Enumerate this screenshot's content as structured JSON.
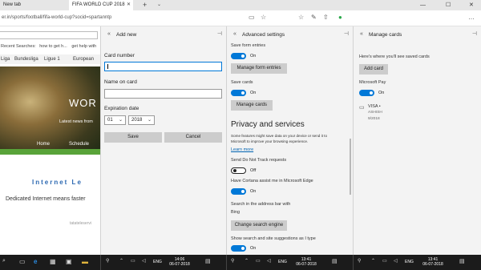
{
  "browser": {
    "tabs": [
      {
        "title": "New tab",
        "active": false
      },
      {
        "title": "FIFA WORLD CUP 2018",
        "active": true
      }
    ],
    "new_tab_icon": "plus-icon",
    "tab_menu_icon": "chevron-down-icon",
    "address_fragment": "er.in/sports/football/fifa-world-cup?socid=spartanntp",
    "window_controls": {
      "minimize": "—",
      "maximize": "☐",
      "close": "✕"
    }
  },
  "webpage": {
    "recent_label": "Recent Searches:",
    "recent_items": [
      "how to get h...",
      "get help with"
    ],
    "leagues": [
      "Liga",
      "Bundesliga",
      "Ligue 1",
      "European"
    ],
    "hero_title": "WOR",
    "hero_subtitle": "Latest news from",
    "hero_nav": [
      "Home",
      "Schedule"
    ],
    "ad_title": "Internet Le",
    "ad_text": "Dedicated Internet means faster",
    "ad_source": "tatateleservi"
  },
  "add_new_pane": {
    "title": "Add new",
    "card_number_label": "Card number",
    "card_number_value": "",
    "name_label": "Name on card",
    "name_value": "",
    "expiration_label": "Expiration date",
    "month_value": "01",
    "year_value": "2018",
    "save_label": "Save",
    "cancel_label": "Cancel"
  },
  "advanced_pane": {
    "title": "Advanced settings",
    "save_form_entries_label": "Save form entries",
    "save_form_entries_state": "On",
    "manage_form_entries_label": "Manage form entries",
    "save_cards_label": "Save cards",
    "save_cards_state": "On",
    "manage_cards_label": "Manage cards",
    "privacy_heading": "Privacy and services",
    "privacy_desc_line1": "Some features might save data on your device or send it to",
    "privacy_desc_line2": "Microsoft to improve your browsing experience.",
    "learn_more_label": "Learn more",
    "dnt_label": "Send Do Not Track requests",
    "dnt_state": "Off",
    "cortana_label": "Have Cortana assist me in Microsoft Edge",
    "cortana_state": "On",
    "search_bar_label": "Search in the address bar with",
    "search_engine_value": "Bing",
    "change_search_label": "Change search engine",
    "suggestions_label": "Show search and site suggestions as I type",
    "suggestions_state": "On"
  },
  "manage_cards_pane": {
    "title": "Manage cards",
    "intro": "Here's where you'll see saved cards",
    "add_card_label": "Add card",
    "microsoft_pay_label": "Microsoft Pay",
    "microsoft_pay_state": "On",
    "card_brand": "VISA •",
    "card_name": "ASHISH",
    "card_expiry": "9/2018"
  },
  "taskbars": [
    {
      "lang": "ENG",
      "time": "14:06",
      "date": "06-07-2018"
    },
    {
      "lang": "ENG",
      "time": "13:41",
      "date": "06-07-2018"
    },
    {
      "lang": "ENG",
      "time": "13:41",
      "date": "06-07-2018"
    }
  ],
  "colors": {
    "accent": "#0078d7",
    "link": "#0063b1",
    "pane_bg": "#f3f3f3",
    "taskbar": "#1b1b1b"
  }
}
